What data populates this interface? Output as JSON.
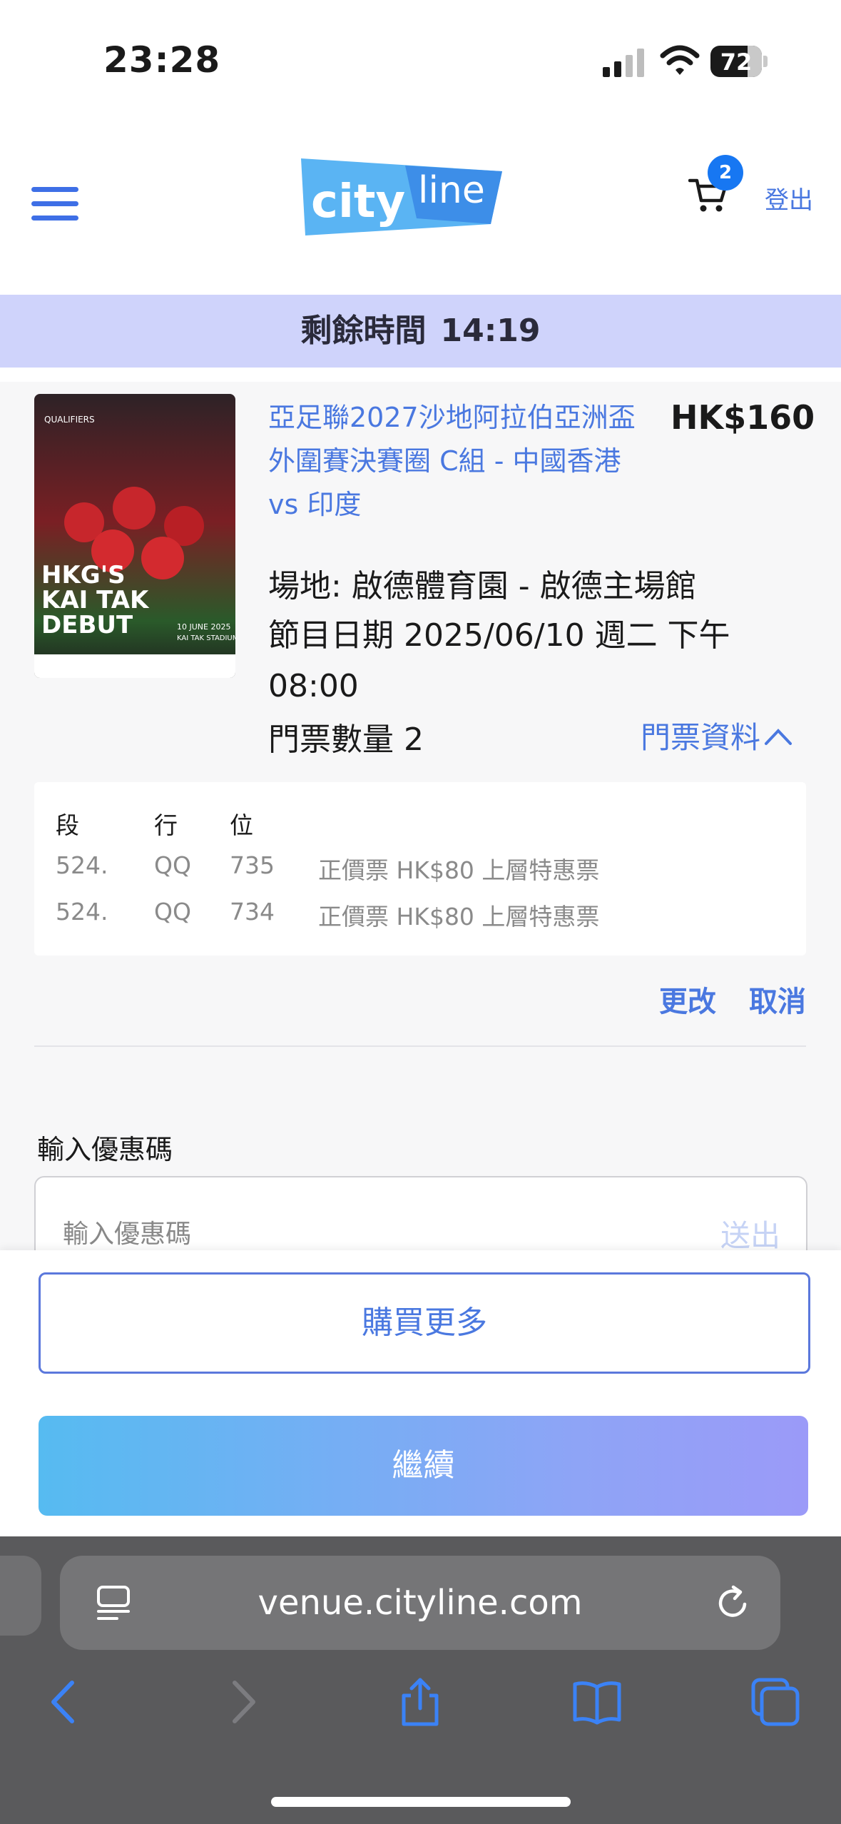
{
  "status_bar": {
    "time": "23:28",
    "battery": "72"
  },
  "header": {
    "logo_text": "cityline",
    "cart_count": "2",
    "logout": "登出"
  },
  "timer": {
    "label": "剩餘時間",
    "value": "14:19"
  },
  "event": {
    "poster_text": [
      "HKG'S",
      "KAI TAK",
      "DEBUT"
    ],
    "poster_date": "10 JUNE 2025",
    "poster_venue": "KAI TAK STADIUM",
    "poster_badge": "QUALIFIERS",
    "title": "亞足聯2027沙地阿拉伯亞洲盃外圍賽決賽圈 C組 - 中國香港 vs 印度",
    "price": "HK$160",
    "venue": "場地: 啟德體育園 - 啟德主場館",
    "date": "節目日期  2025/06/10 週二 下午 08:00",
    "quantity": "門票數量 2",
    "ticket_info_link": "門票資料"
  },
  "tickets": {
    "headers": [
      "段",
      "行",
      "位"
    ],
    "rows": [
      {
        "section": "524.",
        "row": "QQ",
        "seat": "735",
        "type": "正價票 HK$80 上層特惠票"
      },
      {
        "section": "524.",
        "row": "QQ",
        "seat": "734",
        "type": "正價票 HK$80 上層特惠票"
      }
    ]
  },
  "actions": {
    "change": "更改",
    "cancel": "取消"
  },
  "promo": {
    "label": "輸入優惠碼",
    "placeholder": "輸入優惠碼",
    "submit": "送出"
  },
  "buttons": {
    "buy_more": "購買更多",
    "continue": "繼續"
  },
  "browser": {
    "url": "venue.cityline.com"
  },
  "colors": {
    "accent": "#4a78e0",
    "timer_bg": "#cfd3fb",
    "badge": "#1777f2"
  }
}
